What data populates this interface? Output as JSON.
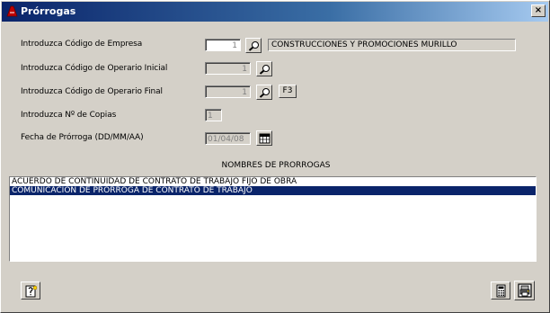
{
  "window": {
    "title": "Prórrogas",
    "close_label": "×"
  },
  "form": {
    "empresa": {
      "label": "Introduzca Código de Empresa",
      "value": "1",
      "description": "CONSTRUCCIONES Y PROMOCIONES MURILLO"
    },
    "operario_inicial": {
      "label": "Introduzca Código de Operario Inicial",
      "value": "1"
    },
    "operario_final": {
      "label": "Introduzca Código de Operario Final",
      "value": "1",
      "f3_label": "F3"
    },
    "copias": {
      "label": "Introduzca Nº de Copias",
      "value": "1"
    },
    "fecha": {
      "label": "Fecha de Prórroga (DD/MM/AA)",
      "value": "01/04/08"
    }
  },
  "list": {
    "title": "NOMBRES DE PRORROGAS",
    "items": [
      {
        "label": "ACUERDO DE CONTINUIDAD DE CONTRATO DE TRABAJO FIJO DE OBRA",
        "selected": false
      },
      {
        "label": "COMUNICACION DE PRORROGA DE CONTRATO DE TRABAJO",
        "selected": true
      }
    ]
  },
  "icons": {
    "title": "app-icon",
    "search": "magnifier-icon",
    "calendar": "calendar-icon",
    "help": "help-icon",
    "calculator": "calculator-icon",
    "print": "print-icon"
  }
}
